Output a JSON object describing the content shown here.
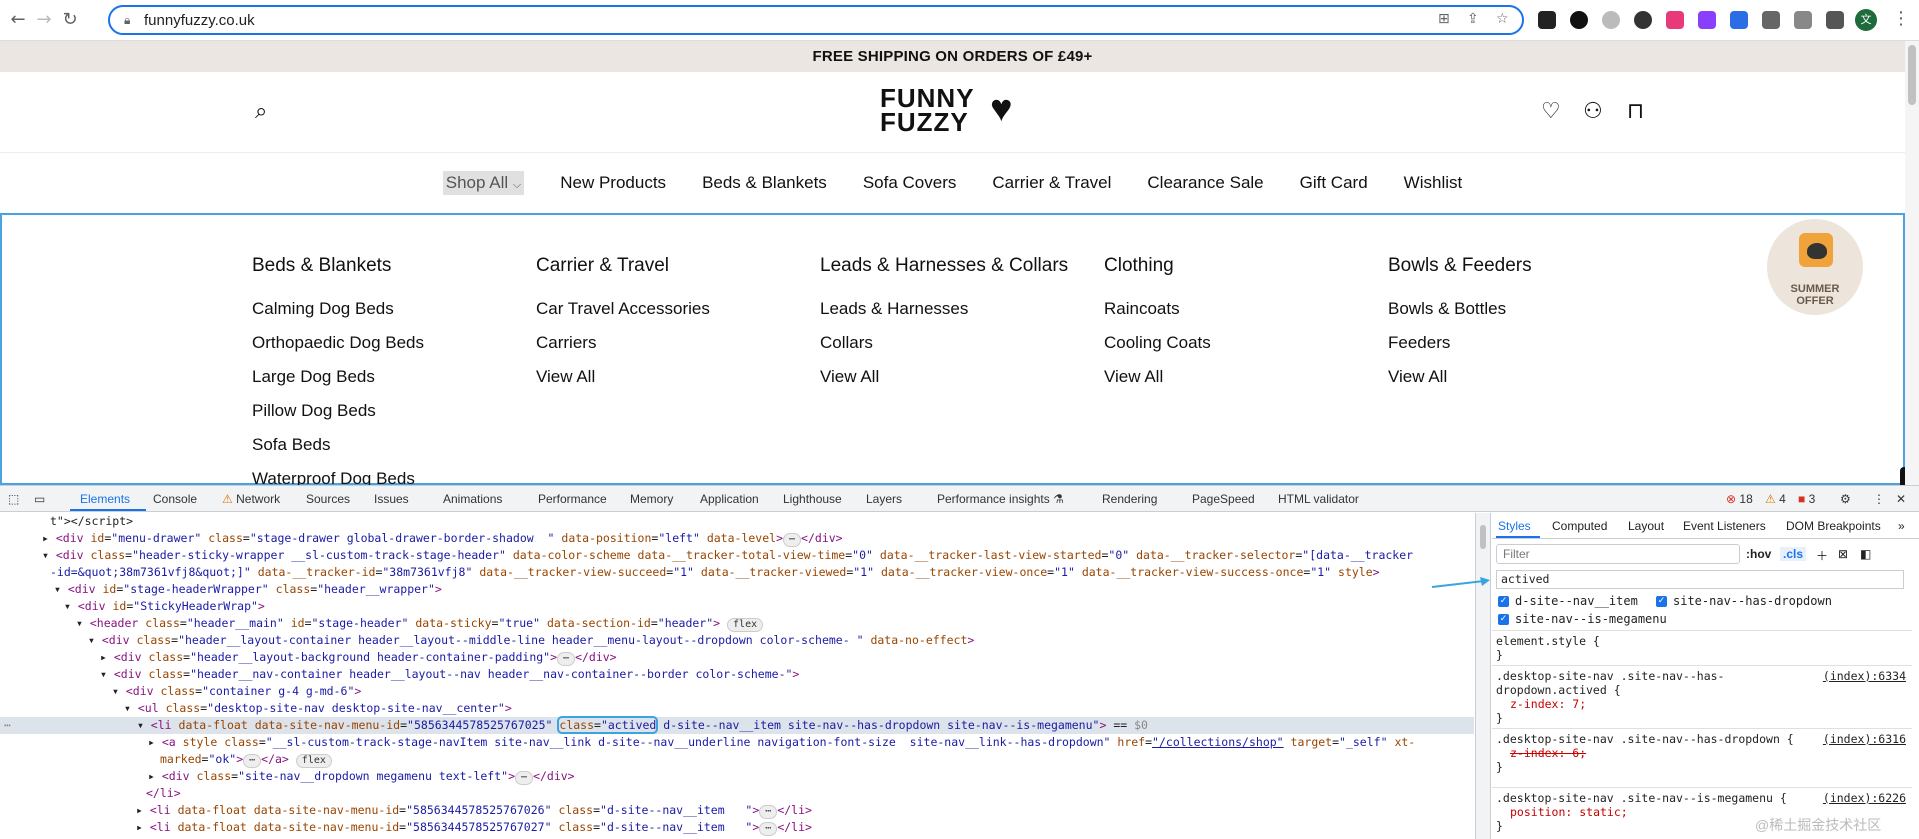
{
  "browser": {
    "url": "funnyfuzzy.co.uk",
    "back_icon": "←",
    "forward_icon": "→",
    "reload_icon": "↻",
    "avatar_initial": "文"
  },
  "site": {
    "announcement": "FREE SHIPPING ON ORDERS OF £49+",
    "logo_line1": "FUNNY",
    "logo_line2": "FUZZY",
    "nav": [
      "Shop All",
      "New Products",
      "Beds & Blankets",
      "Sofa Covers",
      "Carrier & Travel",
      "Clearance Sale",
      "Gift Card",
      "Wishlist"
    ],
    "mega_menu": [
      {
        "heading": "Beds & Blankets",
        "links": [
          "Calming Dog Beds",
          "Orthopaedic Dog Beds",
          "Large Dog Beds",
          "Pillow Dog Beds",
          "Sofa Beds",
          "Waterproof Dog Beds"
        ]
      },
      {
        "heading": "Carrier & Travel",
        "links": [
          "Car Travel Accessories",
          "Carriers",
          "View All"
        ]
      },
      {
        "heading": "Leads & Harnesses & Collars",
        "links": [
          "Leads & Harnesses",
          "Collars",
          "View All"
        ]
      },
      {
        "heading": "Clothing",
        "links": [
          "Raincoats",
          "Cooling Coats",
          "View All"
        ]
      },
      {
        "heading": "Bowls & Feeders",
        "links": [
          "Bowls & Bottles",
          "Feeders",
          "View All"
        ]
      }
    ],
    "badge_line1": "SUMMER",
    "badge_line2": "OFFER"
  },
  "devtools": {
    "tabs": [
      "Elements",
      "Console",
      "Network",
      "Sources",
      "Issues",
      "Animations",
      "Performance",
      "Memory",
      "Application",
      "Lighthouse",
      "Layers",
      "Performance insights",
      "Rendering",
      "PageSpeed",
      "HTML validator"
    ],
    "errors": "18",
    "warnings": "4",
    "issues": "3",
    "styles_tabs": [
      "Styles",
      "Computed",
      "Layout",
      "Event Listeners",
      "DOM Breakpoints"
    ],
    "filter_placeholder": "Filter",
    "hov": ":hov",
    "cls": ".cls",
    "class_input": "actived",
    "class_checks": [
      "d-site--nav__item",
      "site-nav--has-dropdown",
      "site-nav--is-megamenu"
    ],
    "rules": [
      {
        "selector": "element.style {",
        "source": "",
        "props": [],
        "close": "}"
      },
      {
        "selector": ".desktop-site-nav .site-nav--has-dropdown.actived {",
        "source": "(index):6334",
        "props": [
          "z-index: 7;"
        ],
        "close": "}"
      },
      {
        "selector": ".desktop-site-nav .site-nav--has-dropdown {",
        "source": "(index):6316",
        "props": [
          "z-index: 6;"
        ],
        "close": "}"
      },
      {
        "selector": ".desktop-site-nav .site-nav--is-megamenu {",
        "source": "(index):6226",
        "props": [
          "position: static;"
        ],
        "close": "}"
      }
    ],
    "watermark": "@稀土掘金技术社区"
  }
}
